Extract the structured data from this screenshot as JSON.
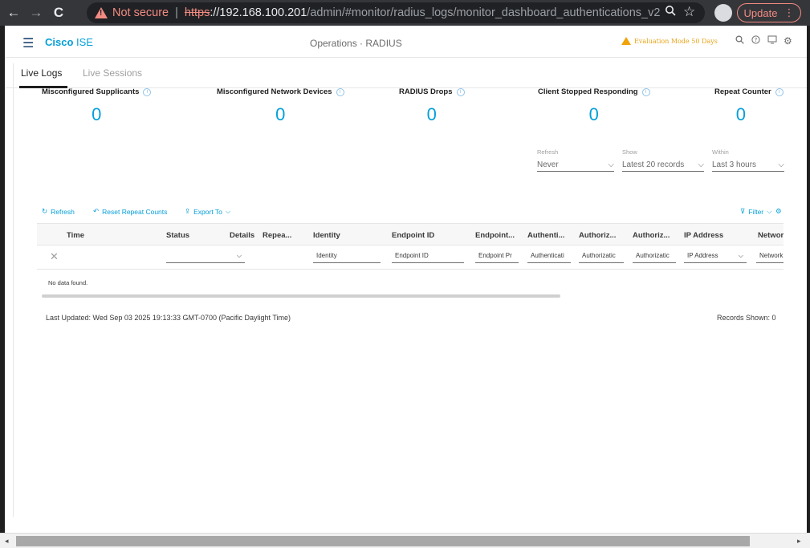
{
  "browser": {
    "back": "←",
    "forward": "→",
    "reload": "C",
    "not_secure": "Not secure",
    "url_scheme": "https",
    "url_host": "://192.168.100.201",
    "url_path": "/admin/#monitor/radius_logs/monitor_dashboard_authentications_v2",
    "update_label": "Update"
  },
  "app": {
    "brand_bold": "Cisco",
    "brand_rest": " ISE",
    "breadcrumb": "Operations · RADIUS",
    "eval_text": "Evaluation Mode 50 Days"
  },
  "tabs": [
    {
      "label": "Live Logs",
      "active": true
    },
    {
      "label": "Live Sessions",
      "active": false
    }
  ],
  "counters": [
    {
      "label": "Misconfigured Supplicants",
      "value": "0"
    },
    {
      "label": "Misconfigured Network Devices",
      "value": "0"
    },
    {
      "label": "RADIUS Drops",
      "value": "0"
    },
    {
      "label": "Client Stopped Responding",
      "value": "0"
    },
    {
      "label": "Repeat Counter",
      "value": "0"
    }
  ],
  "controls": {
    "refresh": {
      "caption": "Refresh",
      "value": "Never"
    },
    "show": {
      "caption": "Show",
      "value": "Latest 20 records"
    },
    "within": {
      "caption": "Within",
      "value": "Last 3 hours"
    }
  },
  "toolbar": {
    "refresh": "Refresh",
    "reset": "Reset Repeat Counts",
    "export": "Export To",
    "filter": "Filter"
  },
  "table": {
    "columns": [
      "Time",
      "Status",
      "Details",
      "Repea...",
      "Identity",
      "Endpoint ID",
      "Endpoint...",
      "Authenti...",
      "Authoriz...",
      "Authoriz...",
      "IP Address",
      "Networ"
    ],
    "filters": [
      "Identity",
      "Endpoint ID",
      "Endpoint Pr",
      "Authenticati",
      "Authorizatic",
      "Authorizatic",
      "IP Address",
      "Network"
    ],
    "empty_text": "No data found."
  },
  "footer": {
    "last_updated": "Last Updated: Wed Sep 03 2025 19:13:33 GMT-0700 (Pacific Daylight Time)",
    "records_shown": "Records Shown: 0"
  },
  "colors": {
    "accent": "#049fd9",
    "warning": "#f0a30a",
    "chrome_alert": "#f28b82"
  }
}
